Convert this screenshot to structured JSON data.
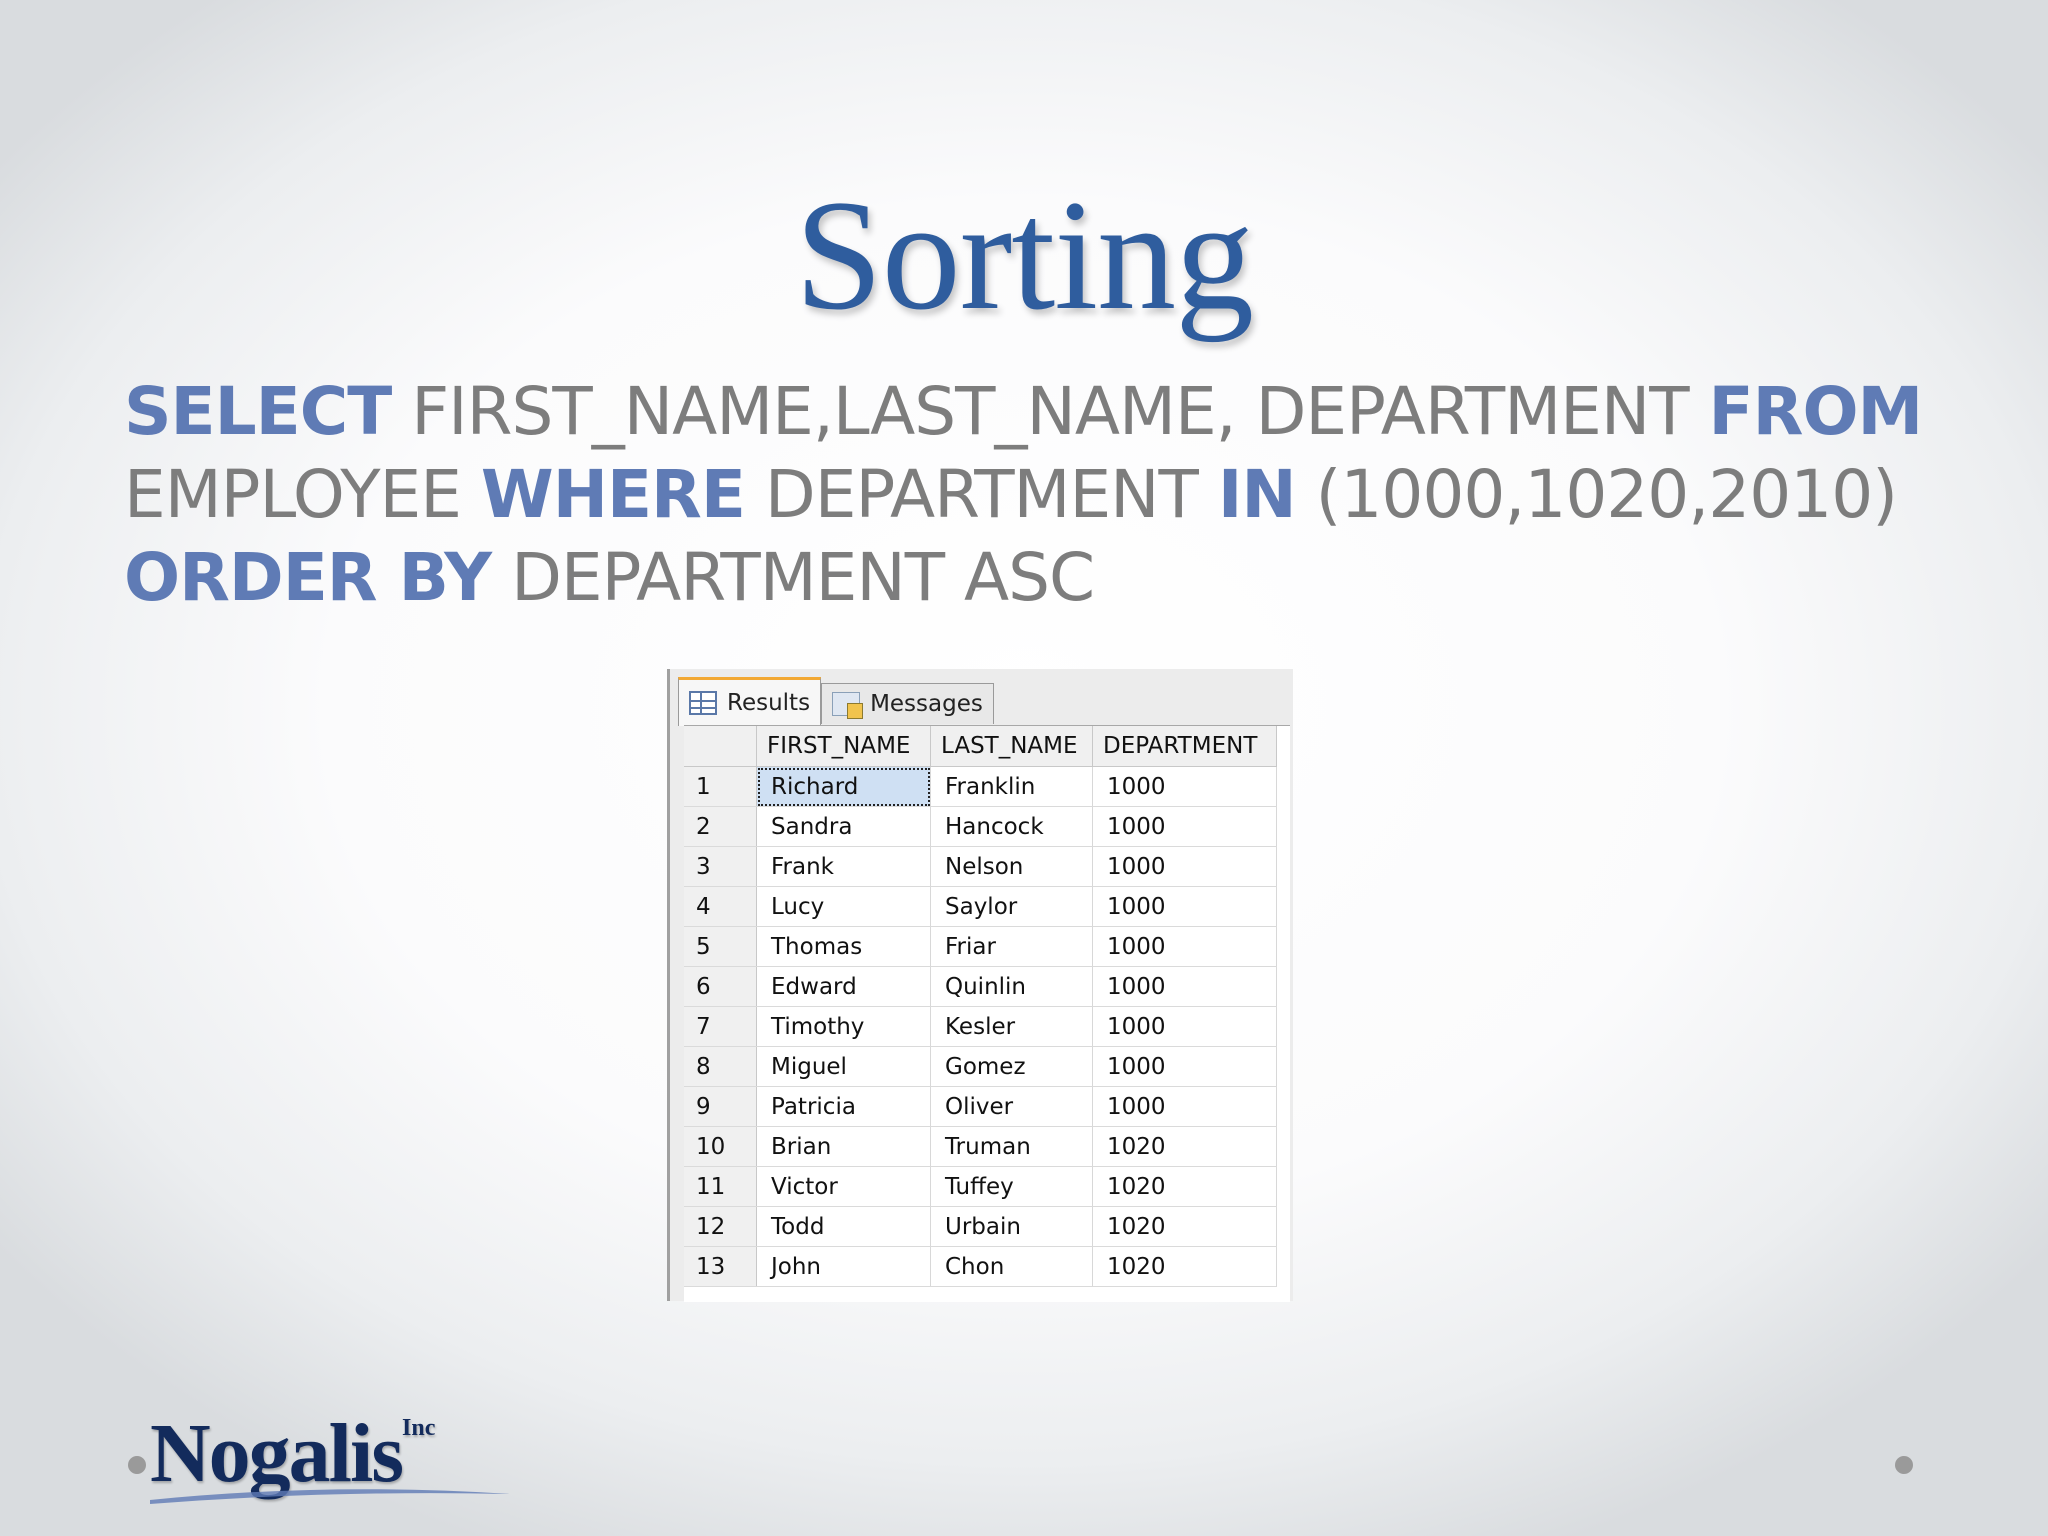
{
  "title": "Sorting",
  "sql": {
    "lines": [
      [
        {
          "t": "SELECT",
          "kw": true
        },
        {
          "t": " FIRST_NAME,LAST_NAME, DEPARTMENT ",
          "kw": false
        },
        {
          "t": "FROM",
          "kw": true
        }
      ],
      [
        {
          "t": "EMPLOYEE ",
          "kw": false
        },
        {
          "t": "WHERE",
          "kw": true
        },
        {
          "t": " DEPARTMENT ",
          "kw": false
        },
        {
          "t": "IN",
          "kw": true
        },
        {
          "t": " (1000,1020,2010)",
          "kw": false
        }
      ],
      [
        {
          "t": "ORDER BY",
          "kw": true
        },
        {
          "t": " DEPARTMENT ASC",
          "kw": false
        }
      ]
    ]
  },
  "tabs": [
    {
      "label": "Results",
      "icon": "results-grid-icon",
      "active": true
    },
    {
      "label": "Messages",
      "icon": "messages-icon",
      "active": false
    }
  ],
  "table": {
    "headers": [
      "",
      "FIRST_NAME",
      "LAST_NAME",
      "DEPARTMENT"
    ],
    "rows": [
      [
        "1",
        "Richard",
        "Franklin",
        "1000"
      ],
      [
        "2",
        "Sandra",
        "Hancock",
        "1000"
      ],
      [
        "3",
        "Frank",
        "Nelson",
        "1000"
      ],
      [
        "4",
        "Lucy",
        "Saylor",
        "1000"
      ],
      [
        "5",
        "Thomas",
        "Friar",
        "1000"
      ],
      [
        "6",
        "Edward",
        "Quinlin",
        "1000"
      ],
      [
        "7",
        "Timothy",
        "Kesler",
        "1000"
      ],
      [
        "8",
        "Miguel",
        "Gomez",
        "1000"
      ],
      [
        "9",
        "Patricia",
        "Oliver",
        "1000"
      ],
      [
        "10",
        "Brian",
        "Truman",
        "1020"
      ],
      [
        "11",
        "Victor",
        "Tuffey",
        "1020"
      ],
      [
        "12",
        "Todd",
        "Urbain",
        "1020"
      ],
      [
        "13",
        "John",
        "Chon",
        "1020"
      ]
    ],
    "selected_cell": {
      "row": 0,
      "col": 1
    }
  },
  "logo": {
    "name": "Nogalis",
    "suffix": "Inc"
  },
  "colors": {
    "title": "#2f5d9e",
    "keyword": "#5f7bb5",
    "text": "#7d7d7d",
    "logo": "#132b5c"
  }
}
